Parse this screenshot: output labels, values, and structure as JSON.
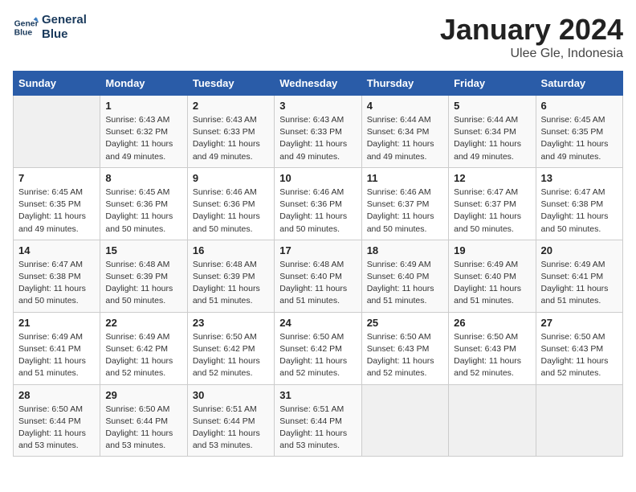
{
  "header": {
    "logo_line1": "General",
    "logo_line2": "Blue",
    "month": "January 2024",
    "location": "Ulee Gle, Indonesia"
  },
  "weekdays": [
    "Sunday",
    "Monday",
    "Tuesday",
    "Wednesday",
    "Thursday",
    "Friday",
    "Saturday"
  ],
  "weeks": [
    [
      {
        "num": "",
        "info": ""
      },
      {
        "num": "1",
        "info": "Sunrise: 6:43 AM\nSunset: 6:32 PM\nDaylight: 11 hours\nand 49 minutes."
      },
      {
        "num": "2",
        "info": "Sunrise: 6:43 AM\nSunset: 6:33 PM\nDaylight: 11 hours\nand 49 minutes."
      },
      {
        "num": "3",
        "info": "Sunrise: 6:43 AM\nSunset: 6:33 PM\nDaylight: 11 hours\nand 49 minutes."
      },
      {
        "num": "4",
        "info": "Sunrise: 6:44 AM\nSunset: 6:34 PM\nDaylight: 11 hours\nand 49 minutes."
      },
      {
        "num": "5",
        "info": "Sunrise: 6:44 AM\nSunset: 6:34 PM\nDaylight: 11 hours\nand 49 minutes."
      },
      {
        "num": "6",
        "info": "Sunrise: 6:45 AM\nSunset: 6:35 PM\nDaylight: 11 hours\nand 49 minutes."
      }
    ],
    [
      {
        "num": "7",
        "info": "Sunrise: 6:45 AM\nSunset: 6:35 PM\nDaylight: 11 hours\nand 49 minutes."
      },
      {
        "num": "8",
        "info": "Sunrise: 6:45 AM\nSunset: 6:36 PM\nDaylight: 11 hours\nand 50 minutes."
      },
      {
        "num": "9",
        "info": "Sunrise: 6:46 AM\nSunset: 6:36 PM\nDaylight: 11 hours\nand 50 minutes."
      },
      {
        "num": "10",
        "info": "Sunrise: 6:46 AM\nSunset: 6:36 PM\nDaylight: 11 hours\nand 50 minutes."
      },
      {
        "num": "11",
        "info": "Sunrise: 6:46 AM\nSunset: 6:37 PM\nDaylight: 11 hours\nand 50 minutes."
      },
      {
        "num": "12",
        "info": "Sunrise: 6:47 AM\nSunset: 6:37 PM\nDaylight: 11 hours\nand 50 minutes."
      },
      {
        "num": "13",
        "info": "Sunrise: 6:47 AM\nSunset: 6:38 PM\nDaylight: 11 hours\nand 50 minutes."
      }
    ],
    [
      {
        "num": "14",
        "info": "Sunrise: 6:47 AM\nSunset: 6:38 PM\nDaylight: 11 hours\nand 50 minutes."
      },
      {
        "num": "15",
        "info": "Sunrise: 6:48 AM\nSunset: 6:39 PM\nDaylight: 11 hours\nand 50 minutes."
      },
      {
        "num": "16",
        "info": "Sunrise: 6:48 AM\nSunset: 6:39 PM\nDaylight: 11 hours\nand 51 minutes."
      },
      {
        "num": "17",
        "info": "Sunrise: 6:48 AM\nSunset: 6:40 PM\nDaylight: 11 hours\nand 51 minutes."
      },
      {
        "num": "18",
        "info": "Sunrise: 6:49 AM\nSunset: 6:40 PM\nDaylight: 11 hours\nand 51 minutes."
      },
      {
        "num": "19",
        "info": "Sunrise: 6:49 AM\nSunset: 6:40 PM\nDaylight: 11 hours\nand 51 minutes."
      },
      {
        "num": "20",
        "info": "Sunrise: 6:49 AM\nSunset: 6:41 PM\nDaylight: 11 hours\nand 51 minutes."
      }
    ],
    [
      {
        "num": "21",
        "info": "Sunrise: 6:49 AM\nSunset: 6:41 PM\nDaylight: 11 hours\nand 51 minutes."
      },
      {
        "num": "22",
        "info": "Sunrise: 6:49 AM\nSunset: 6:42 PM\nDaylight: 11 hours\nand 52 minutes."
      },
      {
        "num": "23",
        "info": "Sunrise: 6:50 AM\nSunset: 6:42 PM\nDaylight: 11 hours\nand 52 minutes."
      },
      {
        "num": "24",
        "info": "Sunrise: 6:50 AM\nSunset: 6:42 PM\nDaylight: 11 hours\nand 52 minutes."
      },
      {
        "num": "25",
        "info": "Sunrise: 6:50 AM\nSunset: 6:43 PM\nDaylight: 11 hours\nand 52 minutes."
      },
      {
        "num": "26",
        "info": "Sunrise: 6:50 AM\nSunset: 6:43 PM\nDaylight: 11 hours\nand 52 minutes."
      },
      {
        "num": "27",
        "info": "Sunrise: 6:50 AM\nSunset: 6:43 PM\nDaylight: 11 hours\nand 52 minutes."
      }
    ],
    [
      {
        "num": "28",
        "info": "Sunrise: 6:50 AM\nSunset: 6:44 PM\nDaylight: 11 hours\nand 53 minutes."
      },
      {
        "num": "29",
        "info": "Sunrise: 6:50 AM\nSunset: 6:44 PM\nDaylight: 11 hours\nand 53 minutes."
      },
      {
        "num": "30",
        "info": "Sunrise: 6:51 AM\nSunset: 6:44 PM\nDaylight: 11 hours\nand 53 minutes."
      },
      {
        "num": "31",
        "info": "Sunrise: 6:51 AM\nSunset: 6:44 PM\nDaylight: 11 hours\nand 53 minutes."
      },
      {
        "num": "",
        "info": ""
      },
      {
        "num": "",
        "info": ""
      },
      {
        "num": "",
        "info": ""
      }
    ]
  ]
}
